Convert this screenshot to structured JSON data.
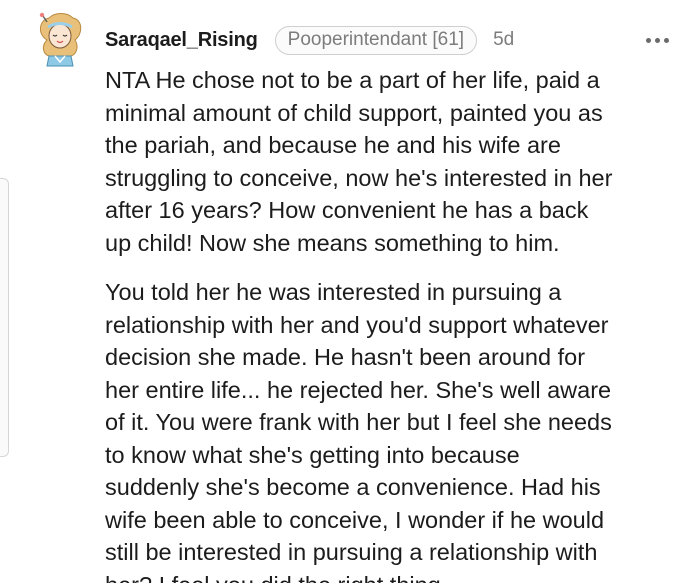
{
  "comment": {
    "username": "Saraqael_Rising",
    "flair": "Pooperintendant [61]",
    "age": "5d",
    "more_icon": "more-horizontal-icon",
    "paragraphs": [
      {
        "lines": [
          "NTA He chose not to be a part of her life, paid a",
          "minimal amount of child support, painted you as",
          "the pariah, and because he and his wife are",
          "struggling to conceive, now he's interested in her",
          "after 16 years? How convenient he has a back",
          "up child! Now she means something to him."
        ]
      },
      {
        "lines": [
          "You told her he was interested in pursuing a",
          "relationship with her and you'd support whatever",
          "decision she made. He hasn't been around for",
          "her entire life... he rejected her. She's well aware",
          "of it. You were frank with her but I feel she needs",
          "to know what she's getting into because",
          "suddenly she's become a convenience. Had his",
          "wife been able to conceive, I wonder if he would",
          "still be interested in pursuing a relationship with",
          "her? I feel you did the right thing."
        ]
      }
    ]
  }
}
